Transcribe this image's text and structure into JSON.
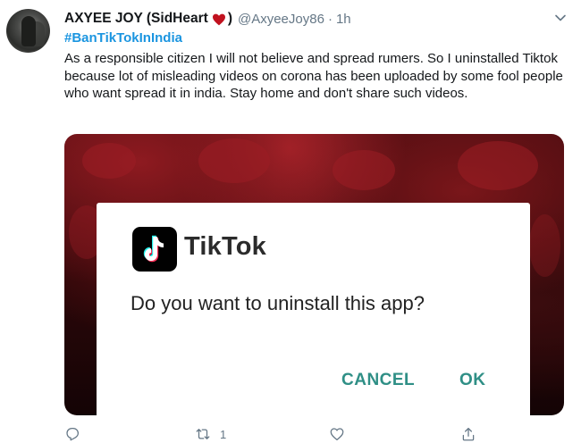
{
  "tweet": {
    "display_name": "AXYEE JOY (SidHeart",
    "name_suffix": ")",
    "name_emoji": "red-heart",
    "handle": "@AxyeeJoy86",
    "separator": "·",
    "time": "1h",
    "hashtag": "#BanTikTokInIndia",
    "text": "As a responsible citizen I will not believe and spread rumers. So I uninstalled Tiktok because lot of misleading videos on corona has been uploaded by some fool people who want spread it in india. Stay home and don't share such videos."
  },
  "media": {
    "dialog": {
      "app_name": "TikTok",
      "question": "Do you want to uninstall this app?",
      "cancel_label": "CANCEL",
      "ok_label": "OK"
    }
  },
  "actions": {
    "reply_icon": "reply-icon",
    "retweet_icon": "retweet-icon",
    "retweet_count": "1",
    "like_icon": "heart-icon",
    "share_icon": "share-icon"
  },
  "colors": {
    "link": "#1b95e0",
    "secondary_text": "#657786",
    "heart": "#c1121f",
    "dialog_button": "#2f8f86",
    "media_background": "#3a0a0d"
  }
}
